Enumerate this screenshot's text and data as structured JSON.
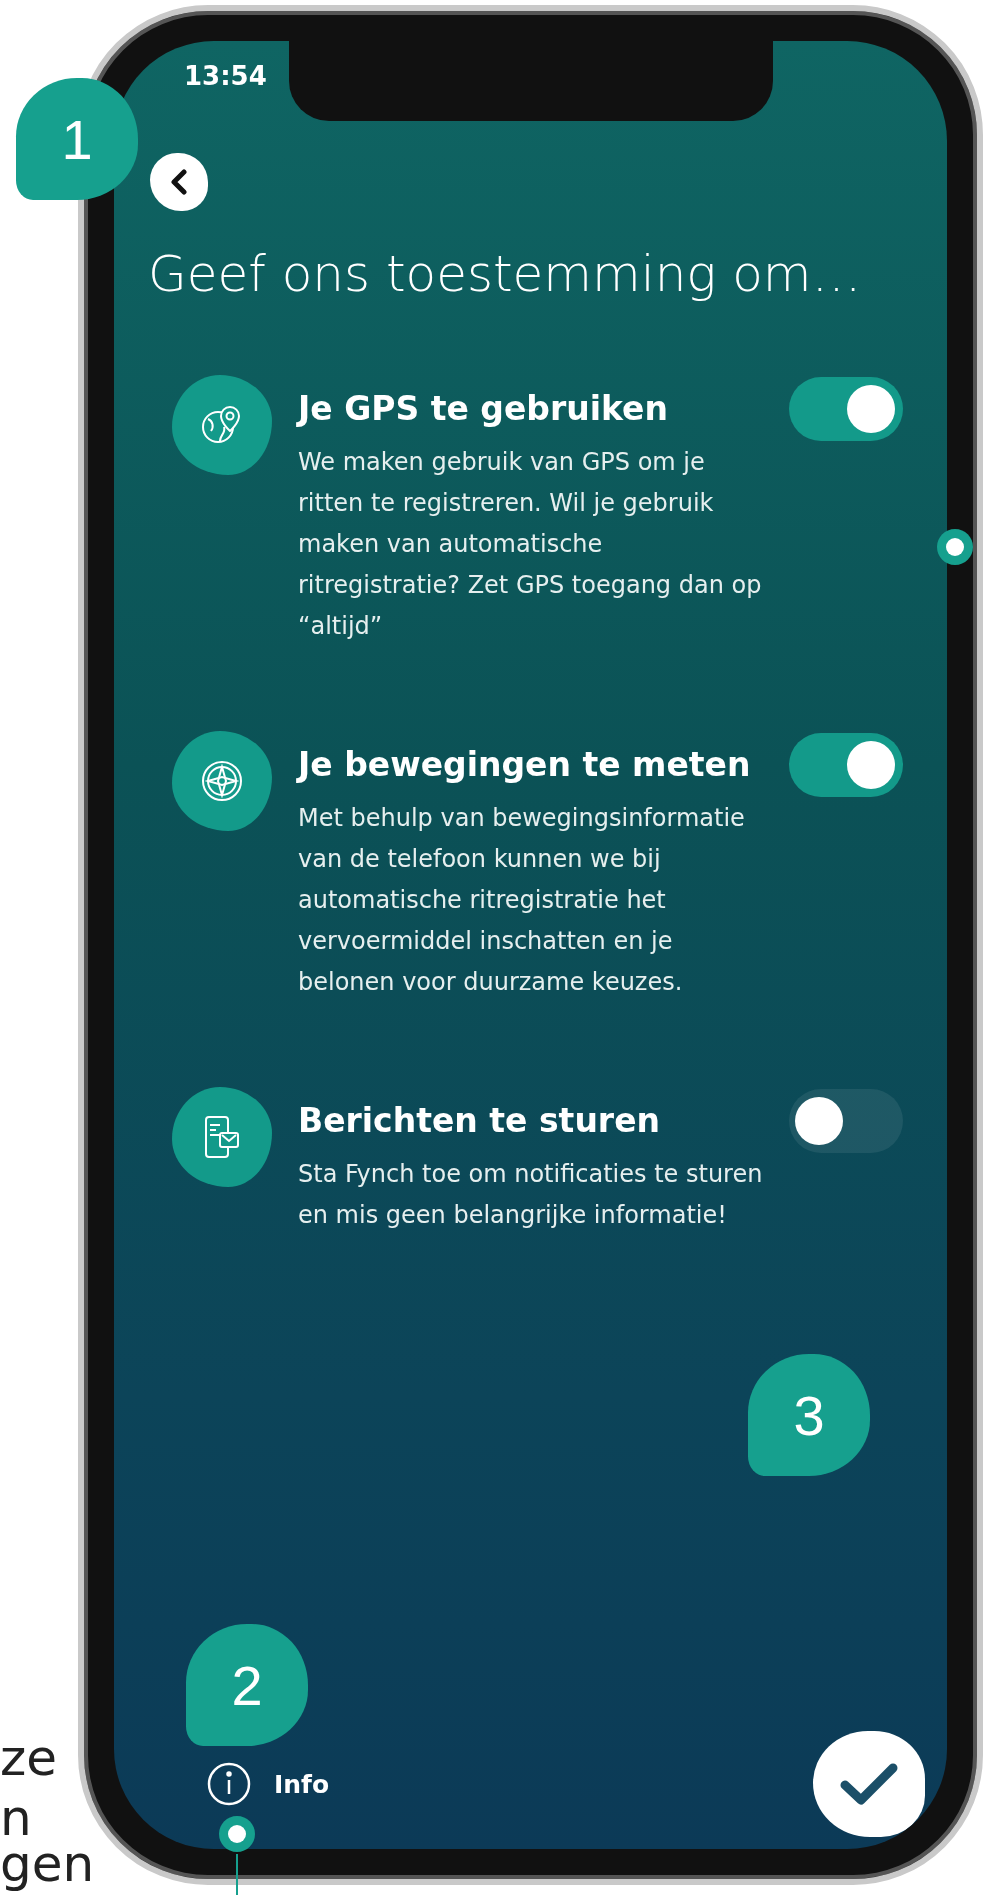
{
  "side_text": [
    "ze",
    "n",
    "gen"
  ],
  "status_bar": {
    "time": "13:54"
  },
  "title": "Geef ons toestemming om…",
  "permissions": [
    {
      "kind": "gps",
      "title": "Je GPS te gebruiken",
      "description": "We maken gebruik van GPS om je ritten te registreren. Wil je gebruik maken van automatische ritregistratie? Zet GPS toegang dan op “altijd”",
      "on": true
    },
    {
      "kind": "motion",
      "title": "Je bewegingen te meten",
      "description": "Met behulp van bewegingsinformatie van de telefoon kunnen we bij automatische ritregistratie het vervoermiddel inschatten en je belonen voor duurzame keuzes.",
      "on": true
    },
    {
      "kind": "notifications",
      "title": "Berichten te sturen",
      "description": "Sta Fynch toe om notificaties te sturen en mis geen belangrijke informatie!",
      "on": false
    }
  ],
  "footer": {
    "info_label": "Info"
  },
  "annotations": [
    {
      "label": "1"
    },
    {
      "label": "2"
    },
    {
      "label": "3"
    }
  ]
}
